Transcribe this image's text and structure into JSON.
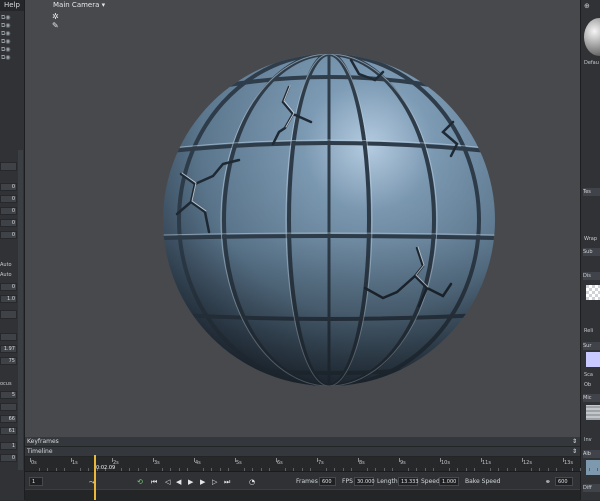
{
  "menu": {
    "help": "Help"
  },
  "viewport": {
    "camera_label": "Main Camera"
  },
  "left_panel": {
    "fields": [
      "0",
      "0",
      "0",
      "0",
      "0",
      "Auto",
      "Auto",
      "0",
      "1.0",
      "0",
      "",
      "1.97",
      "75",
      "",
      "5",
      "",
      "66",
      "61",
      "1",
      "0"
    ],
    "labels": [
      "Auto",
      "Auto",
      "ocus"
    ]
  },
  "right_panel": {
    "material_label": "Defau",
    "sections": [
      "Texture",
      "Subdivision",
      "Displacement",
      "Surface",
      "Microsurface",
      "Albedo",
      "Diffusion"
    ],
    "section_abbrev": [
      "Tes",
      "Sub",
      "Dis",
      "Sur",
      "Mic",
      "Alb",
      "Diff"
    ],
    "labels": [
      "Wrap",
      "Reli",
      "Sca",
      "Ob",
      "Inv"
    ]
  },
  "timeline": {
    "keyframes_label": "Keyframes",
    "timeline_label": "Timeline",
    "ticks": [
      "0s",
      "1s",
      "2s",
      "3s",
      "4s",
      "5s",
      "6s",
      "7s",
      "8s",
      "9s",
      "10s",
      "11s",
      "12s",
      "13s"
    ],
    "current_time": "0:02.09",
    "current_frame": "1",
    "frames_label": "Frames",
    "frames_value": "600",
    "fps_label": "FPS",
    "fps_value": "30.000",
    "length_label": "Length",
    "length_value": "13.333",
    "speed_label": "Speed",
    "speed_value": "1.000",
    "bake_speed_label": "Bake Speed",
    "end_frame": "600"
  },
  "colors": {
    "accent": "#e9b83a",
    "viewport_bg": "#47494d",
    "panel_bg": "#303236",
    "sphere_tile": "#6f8ea8"
  }
}
